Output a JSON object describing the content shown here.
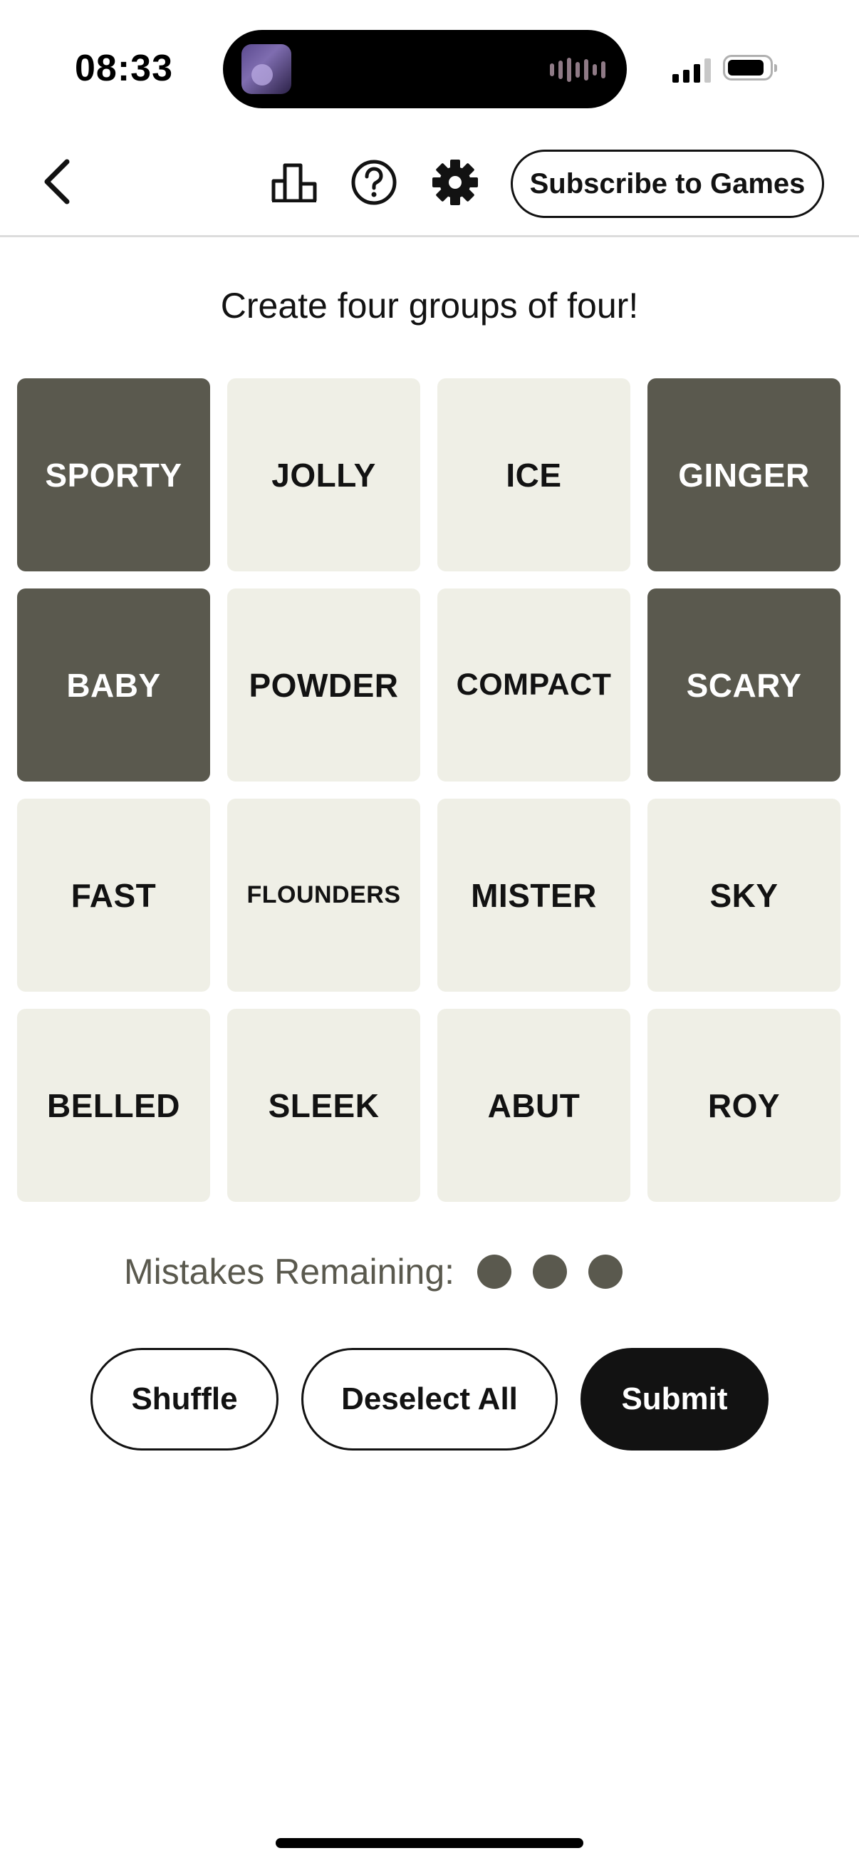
{
  "status_bar": {
    "time": "08:33",
    "icons": [
      "now-playing-thumbnail",
      "audio-waveform-icon",
      "cellular-signal-icon",
      "battery-icon"
    ]
  },
  "toolbar": {
    "back_icon": "chevron-left-icon",
    "stats_icon": "bar-chart-icon",
    "help_icon": "question-circle-icon",
    "settings_icon": "gear-icon",
    "subscribe_label": "Subscribe to Games"
  },
  "game": {
    "instructions": "Create four groups of four!",
    "tiles": [
      {
        "word": "SPORTY",
        "selected": true
      },
      {
        "word": "JOLLY",
        "selected": false
      },
      {
        "word": "ICE",
        "selected": false
      },
      {
        "word": "GINGER",
        "selected": true
      },
      {
        "word": "BABY",
        "selected": true
      },
      {
        "word": "POWDER",
        "selected": false
      },
      {
        "word": "COMPACT",
        "selected": false
      },
      {
        "word": "SCARY",
        "selected": true
      },
      {
        "word": "FAST",
        "selected": false
      },
      {
        "word": "FLOUNDERS",
        "selected": false
      },
      {
        "word": "MISTER",
        "selected": false
      },
      {
        "word": "SKY",
        "selected": false
      },
      {
        "word": "BELLED",
        "selected": false
      },
      {
        "word": "SLEEK",
        "selected": false
      },
      {
        "word": "ABUT",
        "selected": false
      },
      {
        "word": "ROY",
        "selected": false
      }
    ],
    "mistakes_label": "Mistakes Remaining:",
    "mistakes_remaining": 3
  },
  "actions": {
    "shuffle_label": "Shuffle",
    "deselect_label": "Deselect All",
    "submit_label": "Submit"
  },
  "colors": {
    "selected_tile": "#5a594e",
    "unselected_tile": "#efefe6",
    "text": "#121212",
    "submit_bg": "#121212"
  }
}
